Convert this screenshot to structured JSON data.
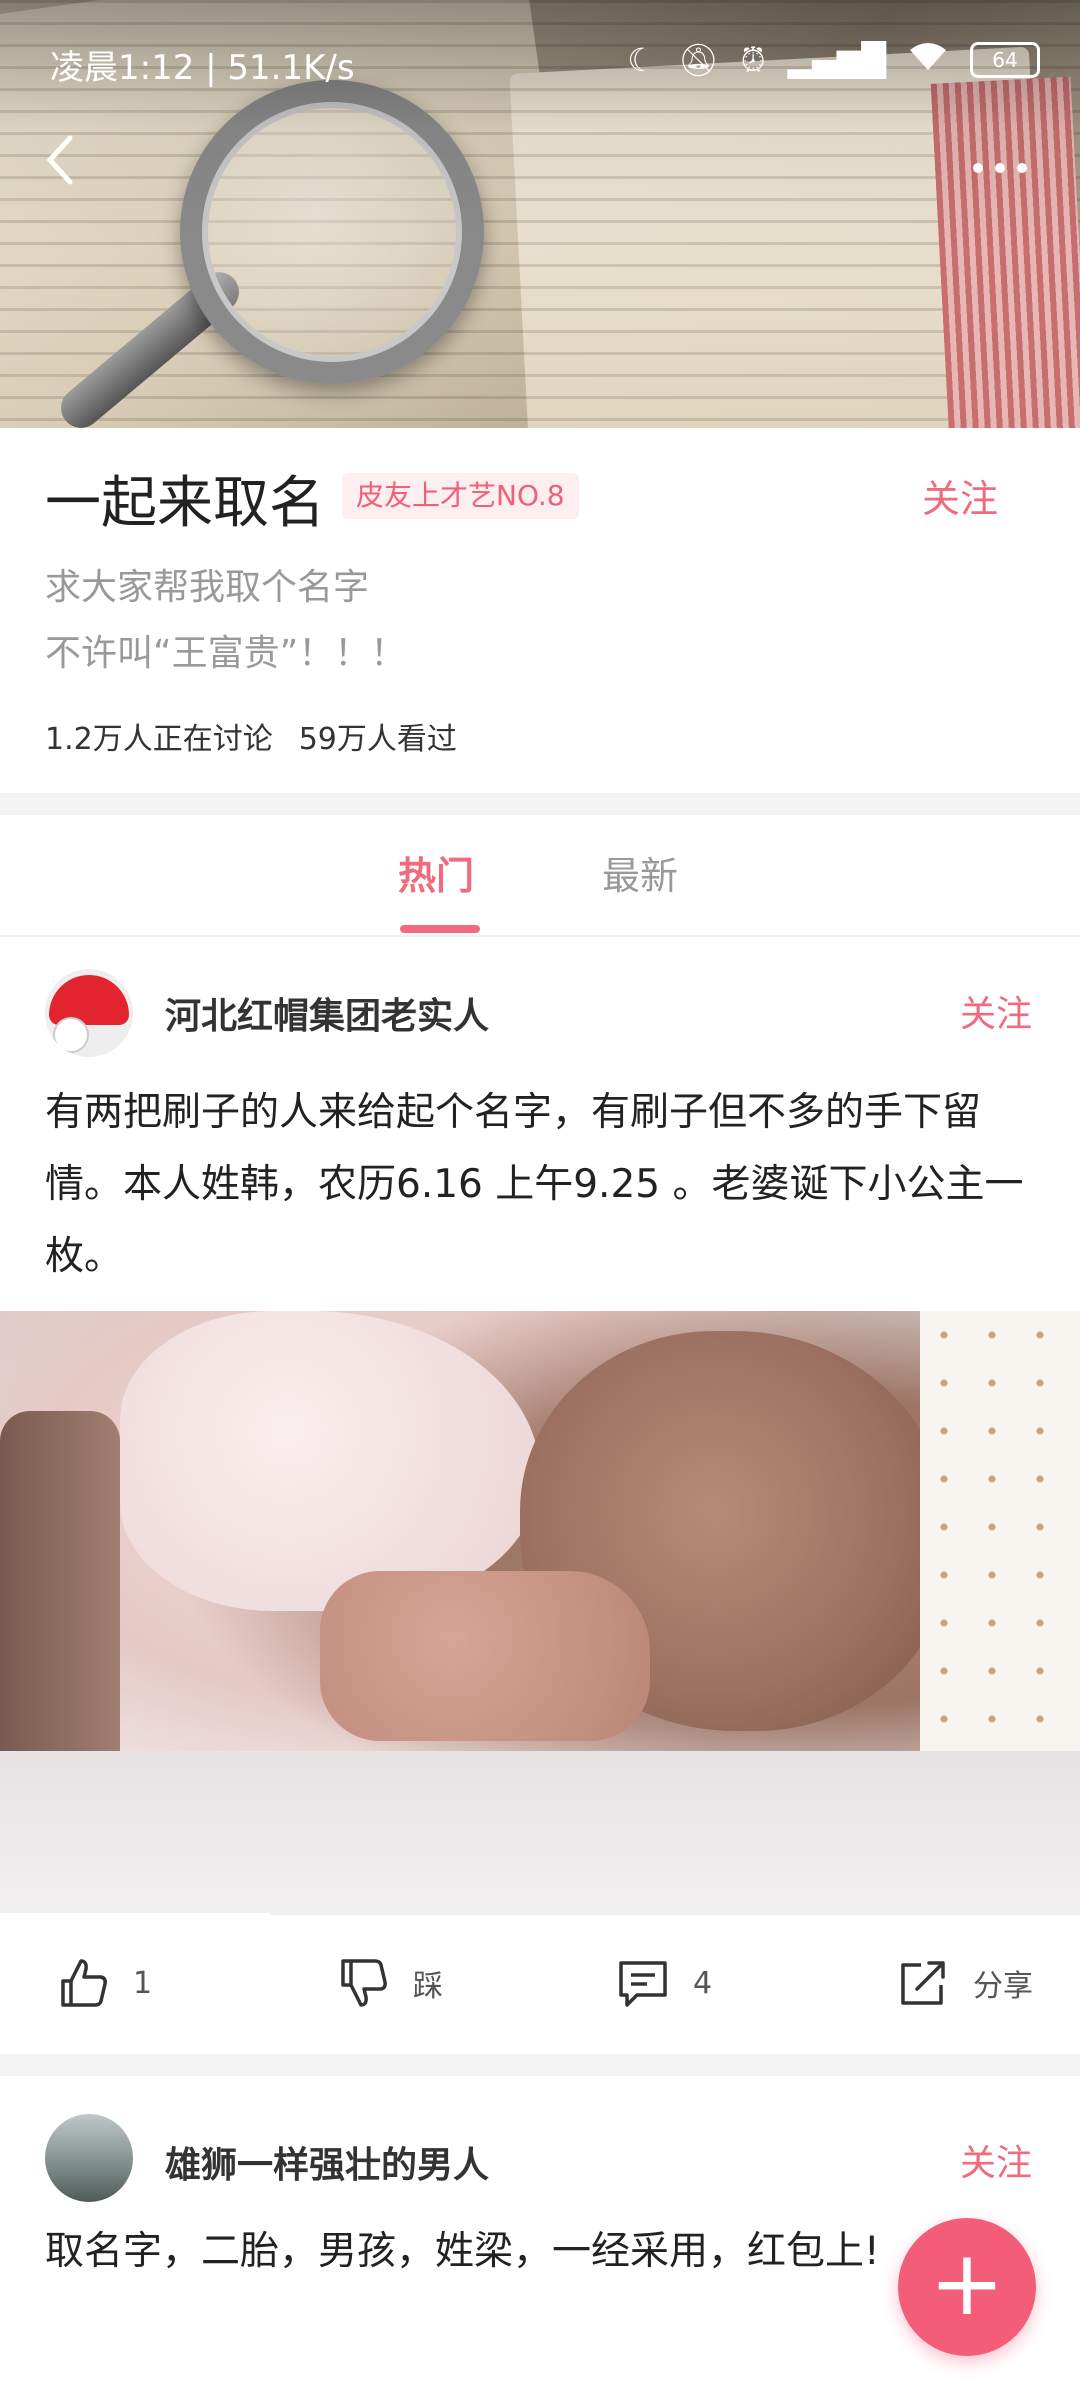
{
  "status_bar": {
    "time_speed": "凌晨1:12 | 51.1K/s",
    "battery": "64",
    "icons": [
      "moon-icon",
      "mute-bell-icon",
      "alarm-icon",
      "signal-icon",
      "wifi-icon",
      "battery-icon"
    ]
  },
  "nav": {
    "back_icon": "chevron-left-icon",
    "more_icon": "more-dots-icon"
  },
  "topic": {
    "title": "一起来取名",
    "badge": "皮友上才艺NO.8",
    "follow": "关注",
    "desc_line1": "求大家帮我取个名字",
    "desc_line2": "不许叫“王富贵”！！！",
    "discussing": "1.2万人正在讨论",
    "viewed": "59万人看过"
  },
  "tabs": {
    "hot": "热门",
    "new": "最新",
    "active": "hot"
  },
  "posts": [
    {
      "author": "河北红帽集团老实人",
      "follow": "关注",
      "text": "有两把刷子的人来给起个名字，有刷子但不多的手下留情。本人姓韩，农历6.16 上午9.25 。老婆诞下小公主一枚。",
      "likes": "1",
      "dislike": "踩",
      "comments": "4",
      "share": "分享"
    },
    {
      "author": "雄狮一样强壮的男人",
      "follow": "关注",
      "text": "取名字，二胎，男孩，姓梁，一经采用，红包上!"
    }
  ],
  "fab": {
    "label": "+"
  },
  "colors": {
    "accent": "#f26a7e",
    "fab": "#f45d78"
  }
}
